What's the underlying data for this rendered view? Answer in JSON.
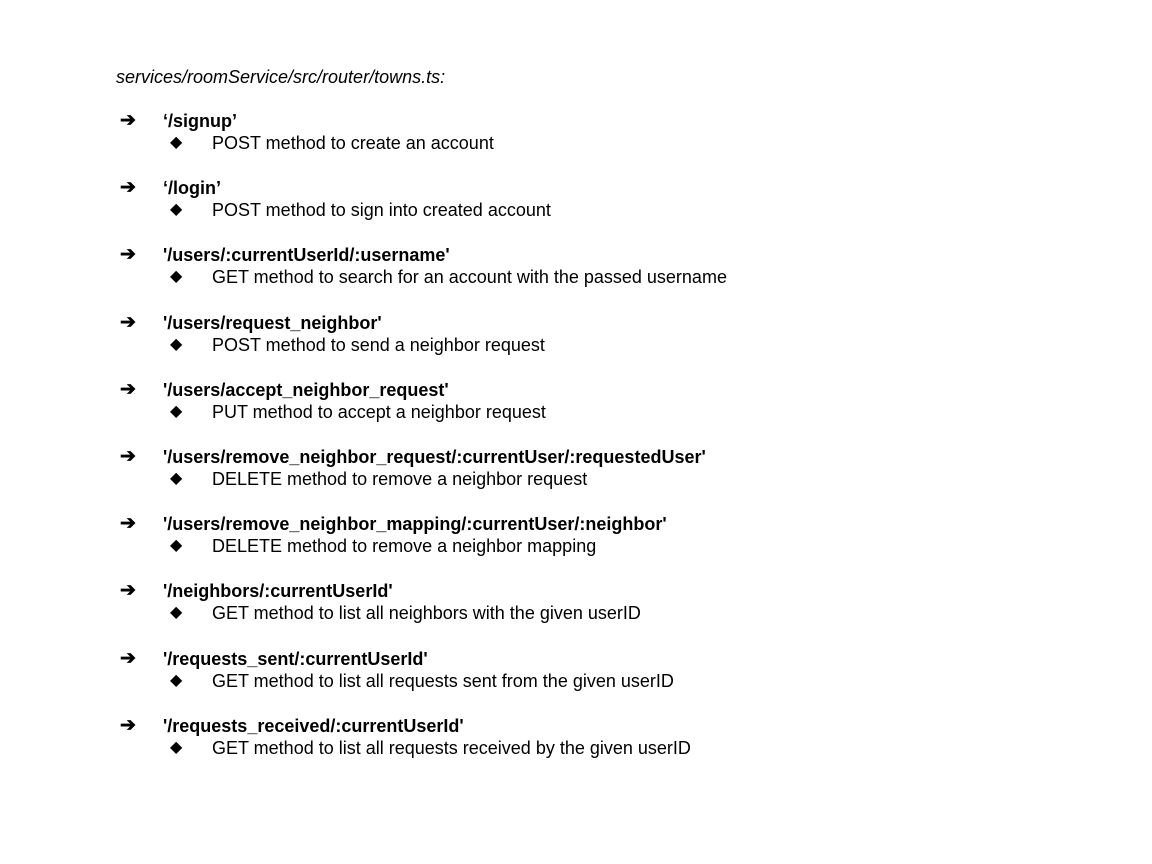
{
  "document": {
    "file_path": "services/roomService/src/router/towns.ts:",
    "bullet_icon": "arrow-right-icon",
    "sub_bullet_icon": "diamond-icon",
    "routes": [
      {
        "path": "‘/signup’",
        "description": "POST method to create an account"
      },
      {
        "path": "‘/login’",
        "description": "POST method to sign into created account"
      },
      {
        "path": "'/users/:currentUserId/:username'",
        "description": "GET method to search for an account with the passed username"
      },
      {
        "path": "'/users/request_neighbor'",
        "description": "POST method to send a neighbor request"
      },
      {
        "path": "'/users/accept_neighbor_request'",
        "description": "PUT method to accept a neighbor request"
      },
      {
        "path": "'/users/remove_neighbor_request/:currentUser/:requestedUser'",
        "description": "DELETE method to remove a neighbor request"
      },
      {
        "path": "'/users/remove_neighbor_mapping/:currentUser/:neighbor'",
        "description": "DELETE method to remove a neighbor mapping"
      },
      {
        "path": "'/neighbors/:currentUserId'",
        "description": "GET method to list all neighbors with the given userID"
      },
      {
        "path": "'/requests_sent/:currentUserId'",
        "description": "GET method to list all requests sent from the given userID"
      },
      {
        "path": "'/requests_received/:currentUserId'",
        "description": "GET method to list all requests received by the given userID"
      }
    ]
  }
}
